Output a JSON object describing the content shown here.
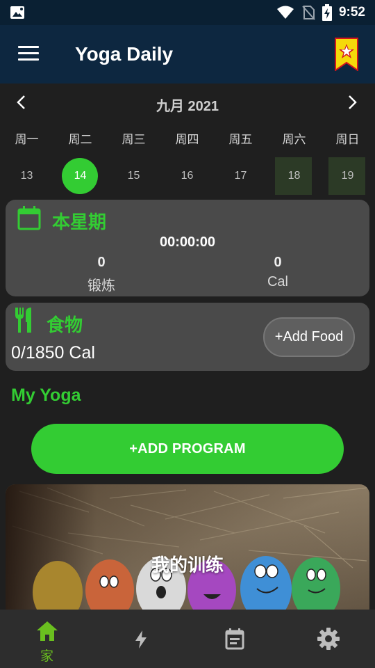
{
  "status_bar": {
    "time": "9:52"
  },
  "app_bar": {
    "title": "Yoga Daily"
  },
  "calendar": {
    "month_label": "九月 2021",
    "weekdays": [
      "周一",
      "周二",
      "周三",
      "周四",
      "周五",
      "周六",
      "周日"
    ],
    "dates": [
      "13",
      "14",
      "15",
      "16",
      "17",
      "18",
      "19"
    ],
    "selected_date": "14"
  },
  "this_week": {
    "title": "本星期",
    "duration": "00:00:00",
    "workouts_value": "0",
    "workouts_label": "锻炼",
    "calories_value": "0",
    "calories_label": "Cal"
  },
  "food": {
    "title": "食物",
    "calories": "0/1850 Cal",
    "add_button": "+Add Food"
  },
  "my_yoga": {
    "title": "My Yoga",
    "add_program_button": "+ADD PROGRAM",
    "program_card_title": "我的训练"
  },
  "bottom_nav": {
    "home_label": "家"
  },
  "colors": {
    "accent_green": "#33cc33",
    "app_bar": "#0d2740",
    "nav_active": "#6abf1f"
  }
}
